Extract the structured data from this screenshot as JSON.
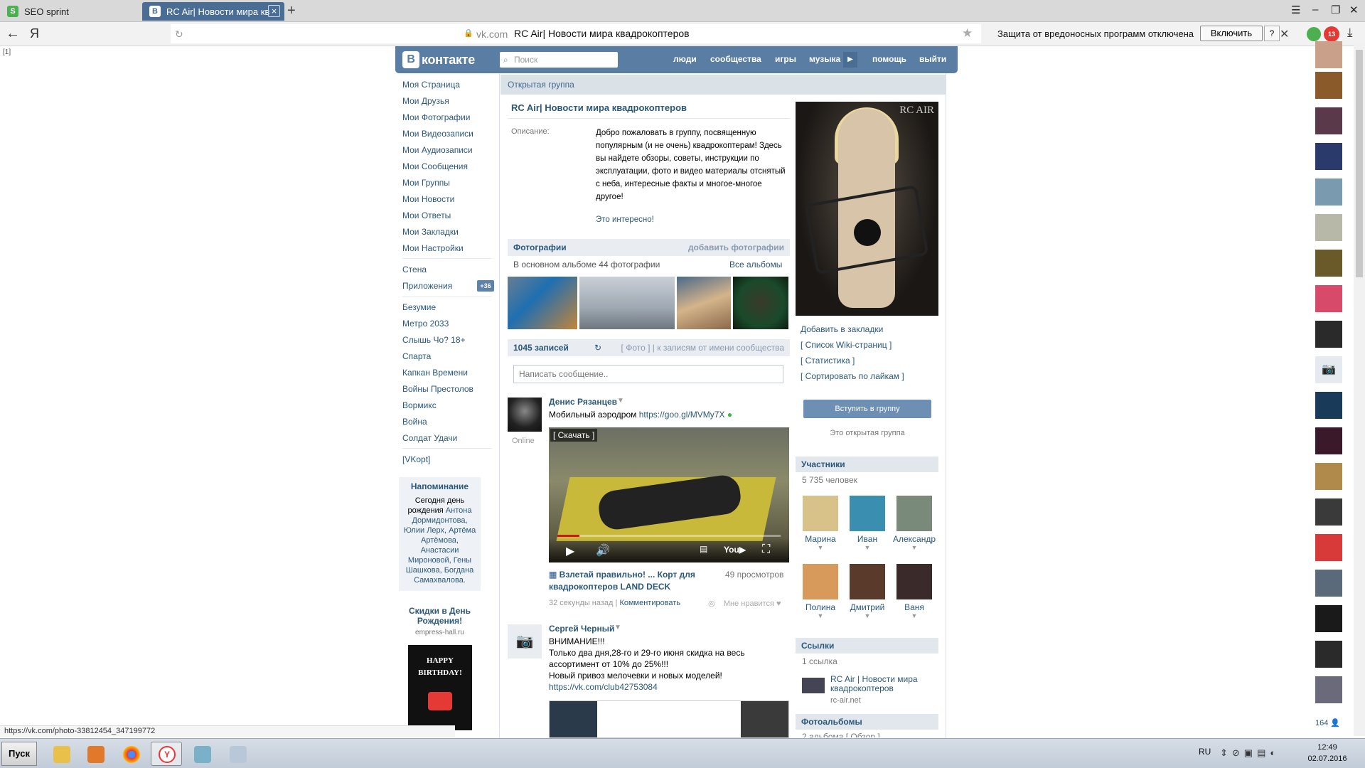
{
  "browser": {
    "tabs": [
      {
        "label": "SEO sprint",
        "favicon": "S"
      },
      {
        "label": "RC Air| Новости мира кв",
        "favicon": "B"
      }
    ],
    "address": {
      "back_glyph": "←",
      "yandex_glyph": "Я",
      "domain": "vk.com",
      "title": "RC Air| Новости мира квадрокоптеров"
    },
    "protection_text": "Защита от вредоносных программ отключена",
    "enable_label": "Включить",
    "help_label": "?",
    "ext_badge": "13",
    "left_marker": "[1]"
  },
  "vk": {
    "logo_text": "контакте",
    "search_placeholder": "Поиск",
    "nav": [
      "люди",
      "сообщества",
      "игры",
      "музыка",
      "помощь",
      "выйти"
    ],
    "left_menu": {
      "main": [
        "Моя Страница",
        "Мои Друзья",
        "Мои Фотографии",
        "Мои Видеозаписи",
        "Мои Аудиозаписи",
        "Мои Сообщения",
        "Мои Группы",
        "Мои Новости",
        "Мои Ответы",
        "Мои Закладки",
        "Мои Настройки"
      ],
      "secondary": [
        "Стена",
        "Приложения"
      ],
      "apps_count": "+36",
      "apps": [
        "Безумие",
        "Метро 2033",
        "Слышь Чо? 18+",
        "Спарта",
        "Капкан Времени",
        "Войны Престолов",
        "Вормикс",
        "Война",
        "Солдат Удачи"
      ],
      "vkopt": "[VKopt]"
    },
    "reminder": {
      "title": "Напоминание",
      "text_prefix": "Сегодня день рождения ",
      "names": "Антона Дормидонтова, Юлии Лерх, Артёма Артёмова, Анастасии Мироновой, Гены Шашкова, Богдана Самахвалова."
    },
    "ad": {
      "title": "Скидки в День Рождения!",
      "site": "empress-hall.ru",
      "image_text": "HAPPY BIRTHDAY!"
    },
    "group": {
      "type": "Открытая группа",
      "name": "RC Air| Новости мира квадрокоптеров",
      "description_label": "Описание:",
      "description": "Добро пожаловать в группу, посвященную популярным (и не очень) квадрокоптерам! Здесь вы найдете обзоры, советы, инструкции по эксплуатации, фото и видео материалы отснятый с неба, интересные факты и многое-многое другое!",
      "description_more": "Это интересно!",
      "photos_title": "Фотографии",
      "photos_add": "добавить фотографии",
      "photos_sub": "В основном альбоме 44 фотографии",
      "all_albums": "Все альбомы",
      "posts_count": "1045 записей",
      "posts_filters": "[ Фото ] | к записям от имени сообщества",
      "post_placeholder": "Написать сообщение..",
      "cover_logo": "RC AIR"
    },
    "posts": [
      {
        "author": "Денис Рязанцев",
        "status": "Online",
        "text": "Мобильный аэродром ",
        "link": "https://goo.gl/MVMy7X",
        "video_download": "[ Скачать ]",
        "video_title": "Взлетай правильно! ... Корт для квадрокоптеров LAND DECK",
        "video_views": "49 просмотров",
        "time": "32 секунды назад",
        "comment": "Комментировать",
        "like": "Мне нравится"
      },
      {
        "author": "Сергей Черный",
        "lines": [
          "ВНИМАНИЕ!!!",
          "Только два дня,28-го и 29-го июня скидка на весь ассортимент от 10% до 25%!!!",
          "Новый привоз мелочевки и новых моделей!"
        ],
        "link": "https://vk.com/club42753084"
      }
    ],
    "right": {
      "links": [
        "Добавить в закладки",
        "[ Список Wiki-страниц ]",
        "[ Статистика ]",
        "[ Сортировать по лайкам ]"
      ],
      "join_label": "Вступить в группу",
      "open_group": "Это открытая группа",
      "members_title": "Участники",
      "members_count": "5 735 человек",
      "members": [
        "Марина",
        "Иван",
        "Александр",
        "Полина",
        "Дмитрий",
        "Ваня"
      ],
      "links_title": "Ссылки",
      "links_count": "1 ссылка",
      "link_title": "RC Air | Новости мира квадрокоптеров",
      "link_site": "rc-air.net",
      "albums_title": "Фотоальбомы",
      "albums_sub": "2 альбома [ Обзор ]"
    },
    "friends_count": "164"
  },
  "status_url": "https://vk.com/photo-33812454_347199772",
  "taskbar": {
    "start": "Пуск",
    "lang": "RU",
    "time": "12:49",
    "date": "02.07.2016"
  }
}
